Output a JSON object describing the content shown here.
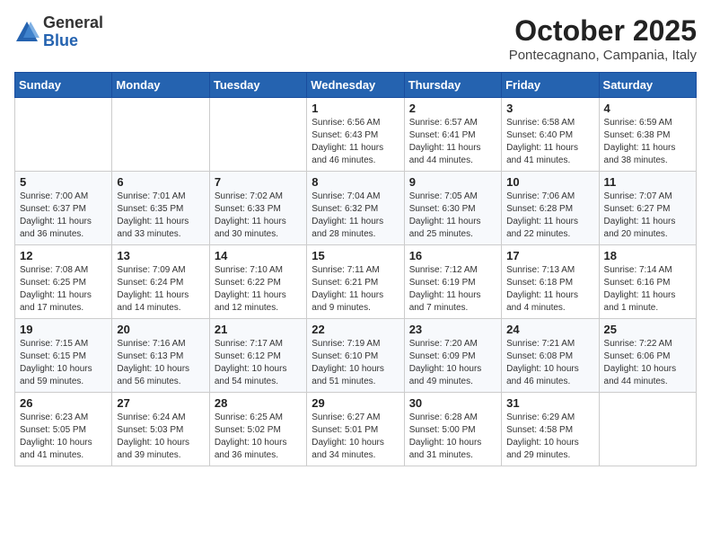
{
  "logo": {
    "general": "General",
    "blue": "Blue"
  },
  "title": "October 2025",
  "subtitle": "Pontecagnano, Campania, Italy",
  "days_of_week": [
    "Sunday",
    "Monday",
    "Tuesday",
    "Wednesday",
    "Thursday",
    "Friday",
    "Saturday"
  ],
  "weeks": [
    [
      {
        "day": "",
        "info": ""
      },
      {
        "day": "",
        "info": ""
      },
      {
        "day": "",
        "info": ""
      },
      {
        "day": "1",
        "info": "Sunrise: 6:56 AM\nSunset: 6:43 PM\nDaylight: 11 hours\nand 46 minutes."
      },
      {
        "day": "2",
        "info": "Sunrise: 6:57 AM\nSunset: 6:41 PM\nDaylight: 11 hours\nand 44 minutes."
      },
      {
        "day": "3",
        "info": "Sunrise: 6:58 AM\nSunset: 6:40 PM\nDaylight: 11 hours\nand 41 minutes."
      },
      {
        "day": "4",
        "info": "Sunrise: 6:59 AM\nSunset: 6:38 PM\nDaylight: 11 hours\nand 38 minutes."
      }
    ],
    [
      {
        "day": "5",
        "info": "Sunrise: 7:00 AM\nSunset: 6:37 PM\nDaylight: 11 hours\nand 36 minutes."
      },
      {
        "day": "6",
        "info": "Sunrise: 7:01 AM\nSunset: 6:35 PM\nDaylight: 11 hours\nand 33 minutes."
      },
      {
        "day": "7",
        "info": "Sunrise: 7:02 AM\nSunset: 6:33 PM\nDaylight: 11 hours\nand 30 minutes."
      },
      {
        "day": "8",
        "info": "Sunrise: 7:04 AM\nSunset: 6:32 PM\nDaylight: 11 hours\nand 28 minutes."
      },
      {
        "day": "9",
        "info": "Sunrise: 7:05 AM\nSunset: 6:30 PM\nDaylight: 11 hours\nand 25 minutes."
      },
      {
        "day": "10",
        "info": "Sunrise: 7:06 AM\nSunset: 6:28 PM\nDaylight: 11 hours\nand 22 minutes."
      },
      {
        "day": "11",
        "info": "Sunrise: 7:07 AM\nSunset: 6:27 PM\nDaylight: 11 hours\nand 20 minutes."
      }
    ],
    [
      {
        "day": "12",
        "info": "Sunrise: 7:08 AM\nSunset: 6:25 PM\nDaylight: 11 hours\nand 17 minutes."
      },
      {
        "day": "13",
        "info": "Sunrise: 7:09 AM\nSunset: 6:24 PM\nDaylight: 11 hours\nand 14 minutes."
      },
      {
        "day": "14",
        "info": "Sunrise: 7:10 AM\nSunset: 6:22 PM\nDaylight: 11 hours\nand 12 minutes."
      },
      {
        "day": "15",
        "info": "Sunrise: 7:11 AM\nSunset: 6:21 PM\nDaylight: 11 hours\nand 9 minutes."
      },
      {
        "day": "16",
        "info": "Sunrise: 7:12 AM\nSunset: 6:19 PM\nDaylight: 11 hours\nand 7 minutes."
      },
      {
        "day": "17",
        "info": "Sunrise: 7:13 AM\nSunset: 6:18 PM\nDaylight: 11 hours\nand 4 minutes."
      },
      {
        "day": "18",
        "info": "Sunrise: 7:14 AM\nSunset: 6:16 PM\nDaylight: 11 hours\nand 1 minute."
      }
    ],
    [
      {
        "day": "19",
        "info": "Sunrise: 7:15 AM\nSunset: 6:15 PM\nDaylight: 10 hours\nand 59 minutes."
      },
      {
        "day": "20",
        "info": "Sunrise: 7:16 AM\nSunset: 6:13 PM\nDaylight: 10 hours\nand 56 minutes."
      },
      {
        "day": "21",
        "info": "Sunrise: 7:17 AM\nSunset: 6:12 PM\nDaylight: 10 hours\nand 54 minutes."
      },
      {
        "day": "22",
        "info": "Sunrise: 7:19 AM\nSunset: 6:10 PM\nDaylight: 10 hours\nand 51 minutes."
      },
      {
        "day": "23",
        "info": "Sunrise: 7:20 AM\nSunset: 6:09 PM\nDaylight: 10 hours\nand 49 minutes."
      },
      {
        "day": "24",
        "info": "Sunrise: 7:21 AM\nSunset: 6:08 PM\nDaylight: 10 hours\nand 46 minutes."
      },
      {
        "day": "25",
        "info": "Sunrise: 7:22 AM\nSunset: 6:06 PM\nDaylight: 10 hours\nand 44 minutes."
      }
    ],
    [
      {
        "day": "26",
        "info": "Sunrise: 6:23 AM\nSunset: 5:05 PM\nDaylight: 10 hours\nand 41 minutes."
      },
      {
        "day": "27",
        "info": "Sunrise: 6:24 AM\nSunset: 5:03 PM\nDaylight: 10 hours\nand 39 minutes."
      },
      {
        "day": "28",
        "info": "Sunrise: 6:25 AM\nSunset: 5:02 PM\nDaylight: 10 hours\nand 36 minutes."
      },
      {
        "day": "29",
        "info": "Sunrise: 6:27 AM\nSunset: 5:01 PM\nDaylight: 10 hours\nand 34 minutes."
      },
      {
        "day": "30",
        "info": "Sunrise: 6:28 AM\nSunset: 5:00 PM\nDaylight: 10 hours\nand 31 minutes."
      },
      {
        "day": "31",
        "info": "Sunrise: 6:29 AM\nSunset: 4:58 PM\nDaylight: 10 hours\nand 29 minutes."
      },
      {
        "day": "",
        "info": ""
      }
    ]
  ]
}
